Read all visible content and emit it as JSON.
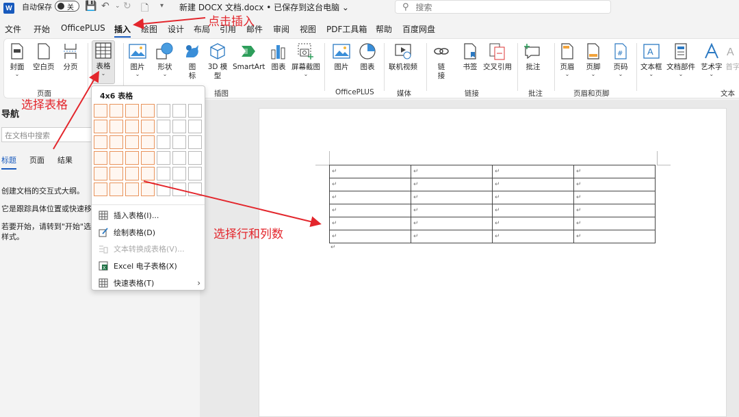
{
  "titlebar": {
    "logo": "W",
    "autosave_label": "自动保存",
    "autosave_state": "关",
    "doc_title": "新建 DOCX 文档.docx • 已保存到这台电脑 ⌄",
    "search_placeholder": "搜索"
  },
  "menu": {
    "tabs": [
      "文件",
      "开始",
      "OfficePLUS",
      "插入",
      "绘图",
      "设计",
      "布局",
      "引用",
      "邮件",
      "审阅",
      "视图",
      "PDF工具箱",
      "帮助",
      "百度网盘"
    ],
    "active_tab": "插入"
  },
  "ribbon": {
    "buttons": {
      "cover": "封面",
      "blank_page": "空白页",
      "page_break": "分页",
      "table": "表格",
      "picture": "图片",
      "shapes": "形状",
      "icons": "图标",
      "model_3d": "3D 模型",
      "smartart": "SmartArt",
      "chart": "图表",
      "screenshot": "屏幕截图",
      "oplus_picture": "图片",
      "oplus_chart": "图表",
      "online_video": "联机视频",
      "link": "链接",
      "bookmark": "书签",
      "cross_ref": "交叉引用",
      "comment": "批注",
      "header": "页眉",
      "footer": "页脚",
      "page_number": "页码",
      "textbox": "文本框",
      "doc_parts": "文档部件",
      "wordart": "艺术字",
      "dropcap": "首字"
    },
    "groups": {
      "pages": "页面",
      "illustrations": "插图",
      "officeplus": "OfficePLUS",
      "media": "媒体",
      "links": "链接",
      "comments": "批注",
      "header_footer": "页眉和页脚",
      "text": "文本"
    }
  },
  "nav": {
    "title": "导航",
    "search_placeholder": "在文档中搜索",
    "tabs": [
      "标题",
      "页面",
      "结果"
    ],
    "active_tab": "标题",
    "line1": "创建文档的交互式大纲。",
    "line2": "它是跟踪具体位置或快速移动",
    "line3": "若要开始，请转到\"开始\"选项",
    "line4": "样式。"
  },
  "table_menu": {
    "title": "4x6 表格",
    "grid_cols": 7,
    "grid_rows": 6,
    "selected_cols": 4,
    "selected_rows": 6,
    "items": [
      {
        "label": "插入表格(I)...",
        "disabled": false
      },
      {
        "label": "绘制表格(D)",
        "disabled": false
      },
      {
        "label": "文本转换成表格(V)...",
        "disabled": true
      },
      {
        "label": "Excel 电子表格(X)",
        "disabled": false
      },
      {
        "label": "快速表格(T)",
        "disabled": false
      }
    ]
  },
  "document": {
    "table_rows": 6,
    "table_cols": 4,
    "cell_mark": "↵"
  },
  "annotations": {
    "click_insert": "点击插入",
    "select_table": "选择表格",
    "select_rows_cols": "选择行和列数",
    "color": "#e3262c"
  }
}
